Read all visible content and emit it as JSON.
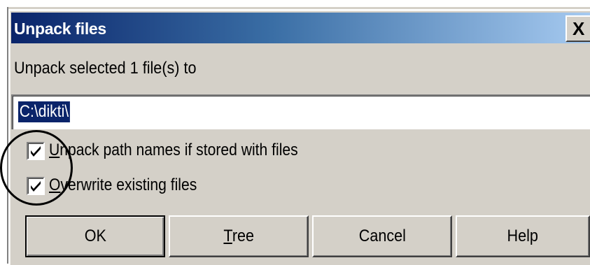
{
  "window": {
    "title": "Unpack files",
    "close_glyph": "X"
  },
  "prompt": "Unpack selected 1 file(s) to",
  "path_input": {
    "value": "C:\\dikti\\"
  },
  "options": [
    {
      "prefix": "",
      "accel": "U",
      "rest": "npack path names if stored with files",
      "checked": true
    },
    {
      "prefix": "",
      "accel": "O",
      "rest": "verwrite existing files",
      "checked": true
    }
  ],
  "buttons": {
    "ok": {
      "label": "OK"
    },
    "tree": {
      "accel": "T",
      "rest": "ree"
    },
    "cancel": {
      "label": "Cancel"
    },
    "help": {
      "label": "Help"
    }
  },
  "icons": {
    "checkmark": "check-icon",
    "close": "close-icon"
  }
}
